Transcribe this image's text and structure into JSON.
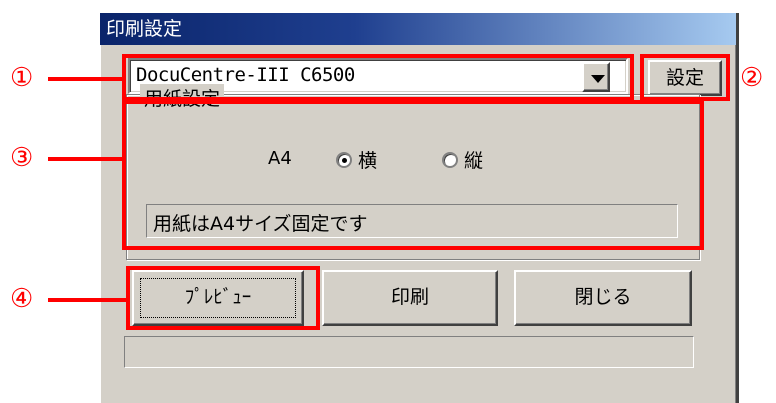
{
  "window": {
    "title": "印刷設定"
  },
  "printer": {
    "selected": "DocuCentre-III C6500",
    "settings_label": "設定"
  },
  "paper": {
    "group_label": "用紙設定",
    "size": "A4",
    "orientation_options": [
      {
        "label": "横",
        "checked": true
      },
      {
        "label": "縦",
        "checked": false
      }
    ],
    "info": "用紙はA4サイズ固定です"
  },
  "buttons": {
    "preview": "ﾌﾟﾚﾋﾞｭｰ",
    "print": "印刷",
    "close": "閉じる"
  },
  "status": "",
  "annotations": {
    "one": "①",
    "two": "②",
    "three": "③",
    "four": "④"
  },
  "colors": {
    "titlebar": "#0a246a",
    "dialog": "#d4d0c8",
    "annotation": "#ff0000"
  }
}
